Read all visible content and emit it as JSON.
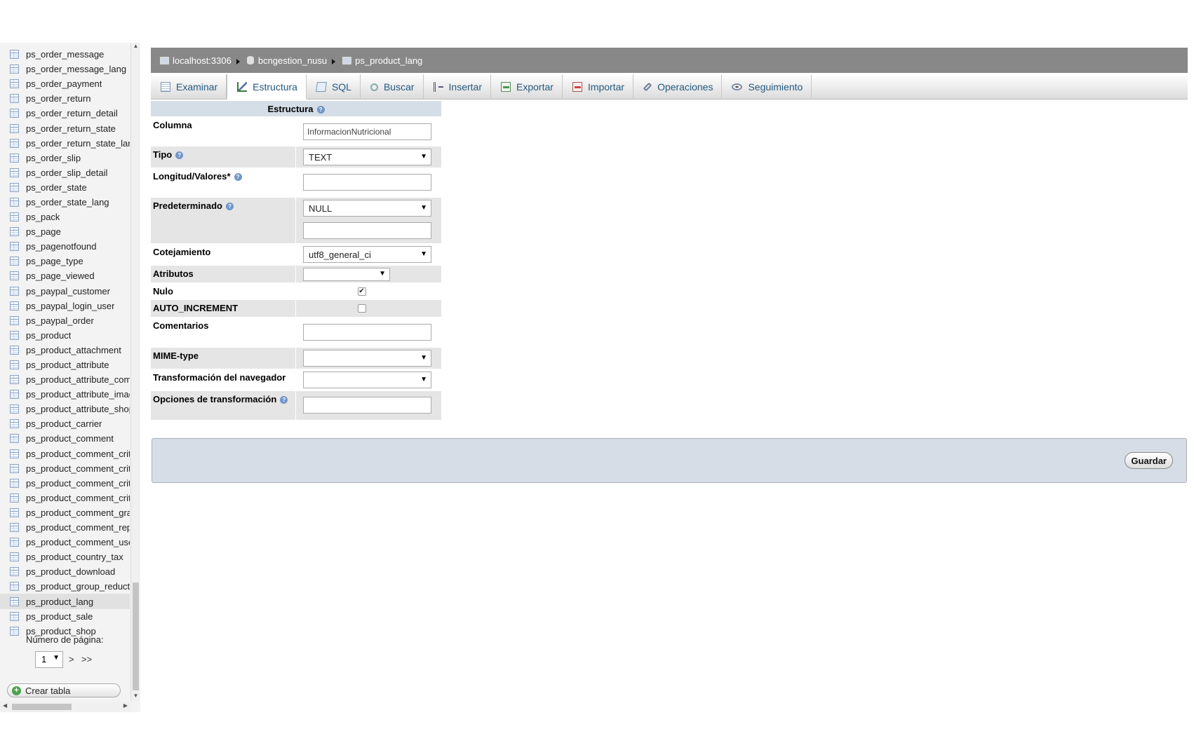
{
  "nav": {
    "tables": [
      "ps_order_message",
      "ps_order_message_lang",
      "ps_order_payment",
      "ps_order_return",
      "ps_order_return_detail",
      "ps_order_return_state",
      "ps_order_return_state_lang",
      "ps_order_slip",
      "ps_order_slip_detail",
      "ps_order_state",
      "ps_order_state_lang",
      "ps_pack",
      "ps_page",
      "ps_pagenotfound",
      "ps_page_type",
      "ps_page_viewed",
      "ps_paypal_customer",
      "ps_paypal_login_user",
      "ps_paypal_order",
      "ps_product",
      "ps_product_attachment",
      "ps_product_attribute",
      "ps_product_attribute_combination",
      "ps_product_attribute_image",
      "ps_product_attribute_shop",
      "ps_product_carrier",
      "ps_product_comment",
      "ps_product_comment_criterion",
      "ps_product_comment_criterion_category",
      "ps_product_comment_criterion_lang",
      "ps_product_comment_criterion_product",
      "ps_product_comment_grade",
      "ps_product_comment_report",
      "ps_product_comment_usefulness",
      "ps_product_country_tax",
      "ps_product_download",
      "ps_product_group_reduction_cache",
      "ps_product_lang",
      "ps_product_sale",
      "ps_product_shop"
    ],
    "active_table": "ps_product_lang",
    "pager_label": "Número de página:",
    "pager_value": "1",
    "pager_next": ">",
    "pager_last": ">>",
    "create_table": "Crear tabla"
  },
  "breadcrumb": {
    "server": "localhost:3306",
    "database": "bcngestion_nusu",
    "table": "ps_product_lang"
  },
  "tabs": [
    {
      "label": "Examinar",
      "icon": "browse-icon"
    },
    {
      "label": "Estructura",
      "icon": "structure-icon"
    },
    {
      "label": "SQL",
      "icon": "sql-icon"
    },
    {
      "label": "Buscar",
      "icon": "search-icon"
    },
    {
      "label": "Insertar",
      "icon": "insert-icon"
    },
    {
      "label": "Exportar",
      "icon": "export-icon"
    },
    {
      "label": "Importar",
      "icon": "import-icon"
    },
    {
      "label": "Operaciones",
      "icon": "operations-icon"
    },
    {
      "label": "Seguimiento",
      "icon": "tracking-icon"
    }
  ],
  "active_tab": "Estructura",
  "form": {
    "header": "Estructura",
    "columna_label": "Columna",
    "columna_value": "InformacionNutricional",
    "tipo_label": "Tipo",
    "tipo_value": "TEXT",
    "longitud_label": "Longitud/Valores*",
    "longitud_value": "",
    "predeterminado_label": "Predeterminado",
    "predeterminado_value": "NULL",
    "predeterminado_text": "",
    "cotejamiento_label": "Cotejamiento",
    "cotejamiento_value": "utf8_general_ci",
    "atributos_label": "Atributos",
    "atributos_value": "",
    "nulo_label": "Nulo",
    "nulo_checked": true,
    "auto_increment_label": "AUTO_INCREMENT",
    "auto_increment_checked": false,
    "comentarios_label": "Comentarios",
    "comentarios_value": "",
    "mime_label": "MIME-type",
    "mime_value": "",
    "transformacion_label": "Transformación del navegador",
    "transformacion_value": "",
    "opciones_label": "Opciones de transformación",
    "opciones_value": ""
  },
  "save_label": "Guardar"
}
